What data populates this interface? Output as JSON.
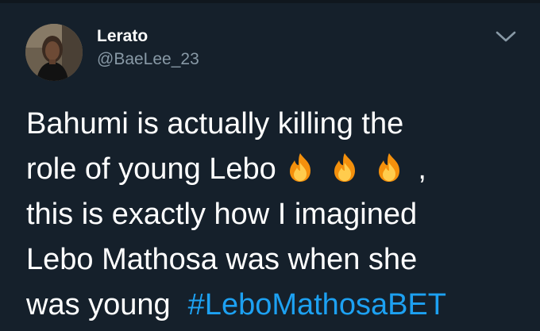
{
  "tweet": {
    "author": {
      "display_name": "Lerato",
      "handle": "@BaeLee_23"
    },
    "text": {
      "line1": "Bahumi is actually killing the",
      "line2_text": "role of young Lebo",
      "line2_after": ",",
      "emojis": [
        "fire-emoji",
        "fire-emoji",
        "fire-emoji"
      ],
      "line3": "this is exactly how I imagined",
      "line4": "Lebo Mathosa was when she",
      "line5_text": "was young",
      "hashtag": "#LeboMathosaBET"
    }
  },
  "icons": {
    "menu": "chevron-down-icon"
  },
  "colors": {
    "background": "#15202b",
    "text": "#ffffff",
    "secondary_text": "#8899a6",
    "link": "#1da1f2"
  }
}
